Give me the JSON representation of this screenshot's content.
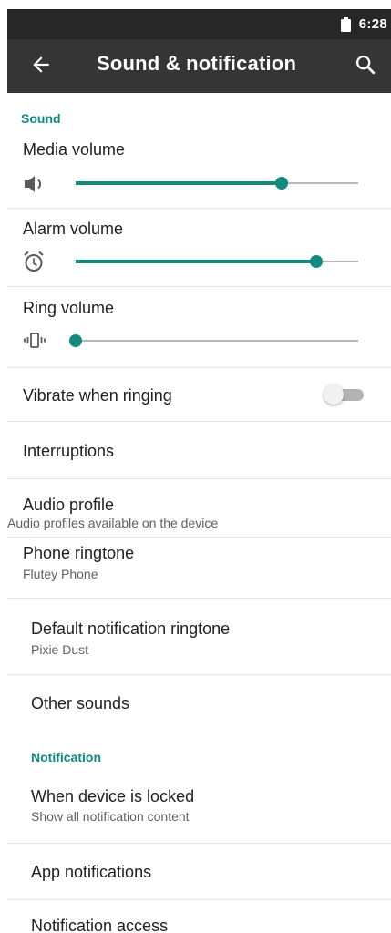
{
  "status_bar": {
    "time": "6:28",
    "battery_icon": "battery-icon"
  },
  "app_bar": {
    "title": "Sound & notification",
    "back_icon": "arrow-back-icon",
    "search_icon": "search-icon"
  },
  "sections": {
    "sound_header": "Sound",
    "notification_header": "Notification"
  },
  "volumes": {
    "media": {
      "label": "Media volume",
      "icon": "speaker-icon",
      "level": 0.73
    },
    "alarm": {
      "label": "Alarm volume",
      "icon": "alarm-icon",
      "level": 0.85
    },
    "ring": {
      "label": "Ring volume",
      "icon": "vibrate-icon",
      "level": 0.0
    }
  },
  "settings": {
    "vibrate_when_ringing": {
      "label": "Vibrate when ringing",
      "on": false
    },
    "interruptions": {
      "label": "Interruptions"
    },
    "audio_profile": {
      "label": "Audio profile",
      "sub": "Audio profiles available on the device"
    },
    "phone_ringtone": {
      "label": "Phone ringtone",
      "sub": "Flutey Phone"
    },
    "default_notification_ringtone": {
      "label": "Default notification ringtone",
      "sub": "Pixie Dust"
    },
    "other_sounds": {
      "label": "Other sounds"
    },
    "when_device_locked": {
      "label": "When device is locked",
      "sub": "Show all notification content"
    },
    "app_notifications": {
      "label": "App notifications"
    },
    "notification_access": {
      "label": "Notification access"
    }
  },
  "colors": {
    "accent": "#128a80",
    "header_text": "#0f8a7f",
    "app_bar": "#353535",
    "status_bar": "#272727"
  }
}
